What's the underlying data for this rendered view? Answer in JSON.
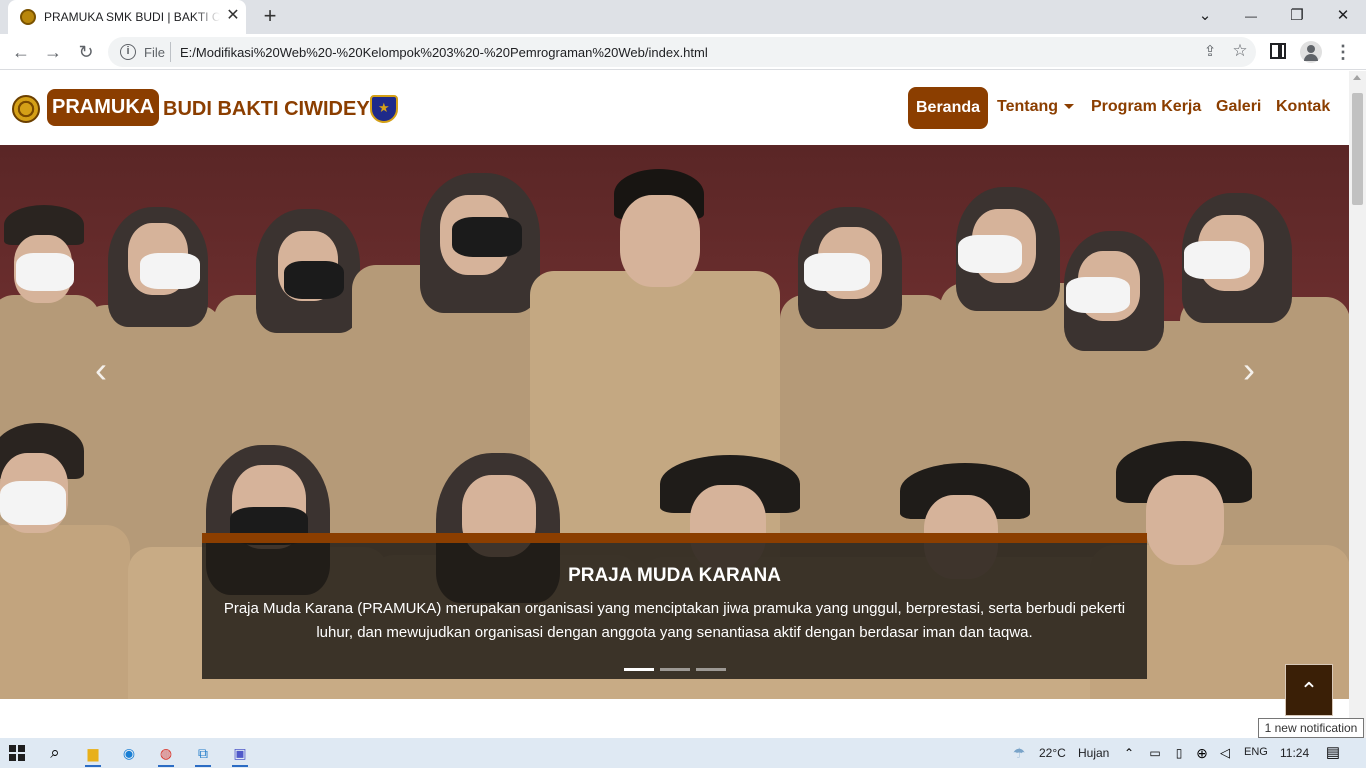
{
  "browser": {
    "tab_title": "PRAMUKA SMK BUDI | BAKTI CIWIDEY",
    "tab_close": "✕",
    "new_tab": "+",
    "url_scheme_label": "File",
    "url": "E:/Modifikasi%20Web%20-%20Kelompok%203%20-%20Pemrograman%20Web/index.html",
    "window_controls": {
      "dropdown": "⌄",
      "minimize": "—",
      "restore": "❐",
      "close": "✕"
    }
  },
  "navbar": {
    "brand_pill": "PRAMUKA",
    "brand_text": "BUDI BAKTI CIWIDEY",
    "links": {
      "home": "Beranda",
      "about": "Tentang",
      "work_program": "Program Kerja",
      "gallery": "Galeri",
      "contact": "Kontak"
    }
  },
  "carousel": {
    "caption_title": "PRAJA MUDA KARANA",
    "caption_body": "Praja Muda Karana (PRAMUKA) merupakan organisasi yang menciptakan jiwa pramuka yang unggul, berprestasi, serta berbudi pekerti luhur, dan mewujudkan organisasi dengan anggota yang senantiasa aktif dengan berdasar iman dan taqwa.",
    "prev_symbol": "‹",
    "next_symbol": "›",
    "slide_count": 3,
    "active_slide": 1
  },
  "back_to_top_symbol": "⌃",
  "notification_tooltip": "1 new notification",
  "taskbar": {
    "weather_temp": "22°C",
    "weather_desc": "Hujan",
    "language": "ENG",
    "time": "11:24"
  },
  "colors": {
    "brand": "#8b3e00",
    "caption_bar": "#8b3e00",
    "back_to_top": "#3a1f06"
  }
}
